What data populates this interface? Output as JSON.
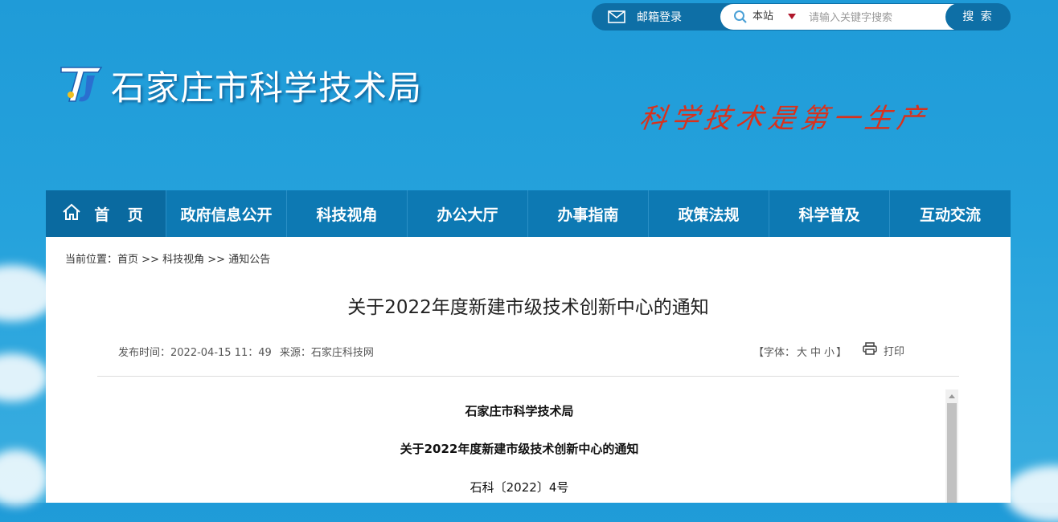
{
  "top": {
    "mail_label": "邮箱登录",
    "search_scope": "本站",
    "search_placeholder": "请输入关键字搜索",
    "search_button": "搜 索"
  },
  "header": {
    "site_title": "石家庄市科学技术局",
    "slogan": "科学技术是第一生产"
  },
  "nav": {
    "items": [
      {
        "label": "首 页"
      },
      {
        "label": "政府信息公开"
      },
      {
        "label": "科技视角"
      },
      {
        "label": "办公大厅"
      },
      {
        "label": "办事指南"
      },
      {
        "label": "政策法规"
      },
      {
        "label": "科学普及"
      },
      {
        "label": "互动交流"
      }
    ]
  },
  "breadcrumb": {
    "prefix": "当前位置：",
    "items": [
      "首页",
      "科技视角",
      "通知公告"
    ],
    "sep": ">>"
  },
  "article": {
    "title": "关于2022年度新建市级技术创新中心的通知",
    "publish_time": "发布时间：2022-04-15 11：49",
    "source": "来源：石家庄科技网",
    "font_label_open": "【字体：",
    "font_sizes": [
      "大",
      "中",
      "小"
    ],
    "font_label_close": "】",
    "print_label": "打印",
    "body": {
      "org": "石家庄市科学技术局",
      "heading": "关于2022年度新建市级技术创新中心的通知",
      "doc_no": "石科〔2022〕4号"
    }
  },
  "colors": {
    "nav_bg": "#0d79b3",
    "topbar_bg": "#0e6fa6",
    "slogan": "#d9311c"
  }
}
